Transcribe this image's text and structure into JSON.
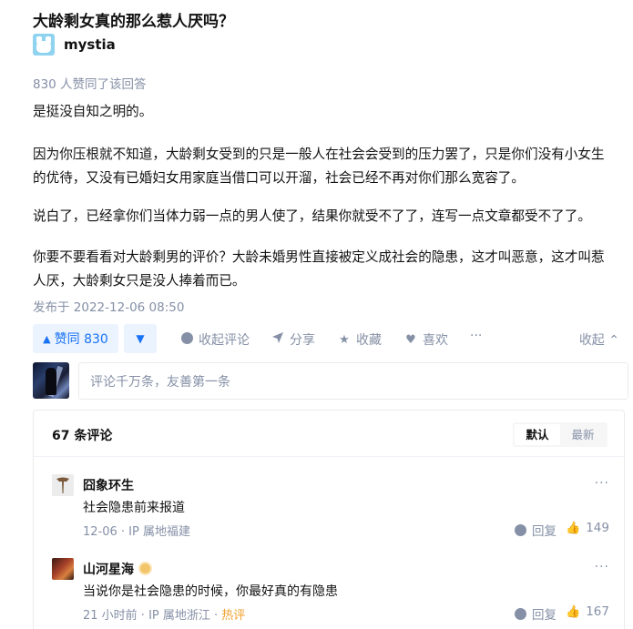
{
  "question": {
    "title": "大龄剩女真的那么惹人厌吗？"
  },
  "author": {
    "name": "mystia",
    "avatar_icon": "author-avatar-icon"
  },
  "answer": {
    "vote_summary": "830 人赞同了该回答",
    "paragraphs": [
      "是挺没自知之明的。",
      "因为你压根就不知道，大龄剩女受到的只是一般人在社会会受到的压力罢了，只是你们没有小女生的优待，又没有已婚妇女用家庭当借口可以开溜，社会已经不再对你们那么宽容了。",
      "说白了，已经拿你们当体力弱一点的男人使了，结果你就受不了了，连写一点文章都受不了了。",
      "你要不要看看对大龄剩男的评价？大龄未婚男性直接被定义成社会的隐患，这才叫恶意，这才叫惹人厌，大龄剩女只是没人捧着而已。"
    ],
    "publish_time": "发布于 2022-12-06 08:50"
  },
  "actions": {
    "vote_up_label": "赞同 830",
    "vote_up_icon": "▲",
    "vote_down_icon": "▼",
    "comment_label": "收起评论",
    "share_label": "分享",
    "favorite_label": "收藏",
    "like_label": "喜欢",
    "more_label": "···",
    "collapse_label": "收起 ⌃"
  },
  "comment_input": {
    "placeholder": "评论千万条，友善第一条"
  },
  "comments": {
    "count_label": "67 条评论",
    "sort_default": "默认",
    "sort_latest": "最新",
    "items": [
      {
        "name": "囧象环生",
        "text": "社会隐患前来报道",
        "meta": "12-06 · IP 属地福建",
        "hot": "",
        "reply_label": "回复",
        "likes": "149",
        "more": "···"
      },
      {
        "name": "山河星海",
        "text": "当说你是社会隐患的时候，你最好真的有隐患",
        "meta": "21 小时前 · IP 属地浙江 · ",
        "hot": "热评",
        "reply_label": "回复",
        "likes": "167",
        "more": "···"
      }
    ]
  },
  "colors": {
    "accent": "#1772f6",
    "accent_bg": "#ebf3ff",
    "muted": "#8590a6",
    "hot": "#f1a02c"
  }
}
